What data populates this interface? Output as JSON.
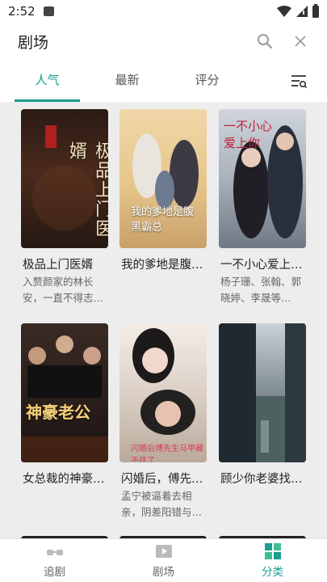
{
  "statusbar": {
    "time": "2:52"
  },
  "header": {
    "title": "剧场"
  },
  "tabs": [
    {
      "label": "人气",
      "active": true
    },
    {
      "label": "最新",
      "active": false
    },
    {
      "label": "评分",
      "active": false
    }
  ],
  "cards": [
    {
      "title": "极品上门医婿",
      "desc": "入赘颜家的林长安，一直不得志…",
      "poster_text": "极品上门医婿"
    },
    {
      "title": "我的爹地是腹…",
      "desc": "",
      "poster_text": "我的爹地是腹黑霸总"
    },
    {
      "title": "一不小心爱上…",
      "desc": "杨子珊、张翰、郭晓婷、李晟等…",
      "poster_text": "一不小心爱上你"
    },
    {
      "title": "女总裁的神豪…",
      "desc": "",
      "poster_text": "神豪老公"
    },
    {
      "title": "闪婚后，傅先…",
      "desc": "孟宁被逼着去相亲，阴差阳错与…",
      "poster_text": "闪婚后傅先生马甲藏不住了"
    },
    {
      "title": "顾少你老婆找…",
      "desc": "",
      "poster_text": ""
    }
  ],
  "bottom_nav": [
    {
      "label": "追剧",
      "icon": "glasses-icon",
      "active": false
    },
    {
      "label": "剧场",
      "icon": "film-icon",
      "active": false
    },
    {
      "label": "分类",
      "icon": "grid-icon",
      "active": true
    }
  ],
  "colors": {
    "accent": "#1a9e8f",
    "background": "#ededed"
  }
}
